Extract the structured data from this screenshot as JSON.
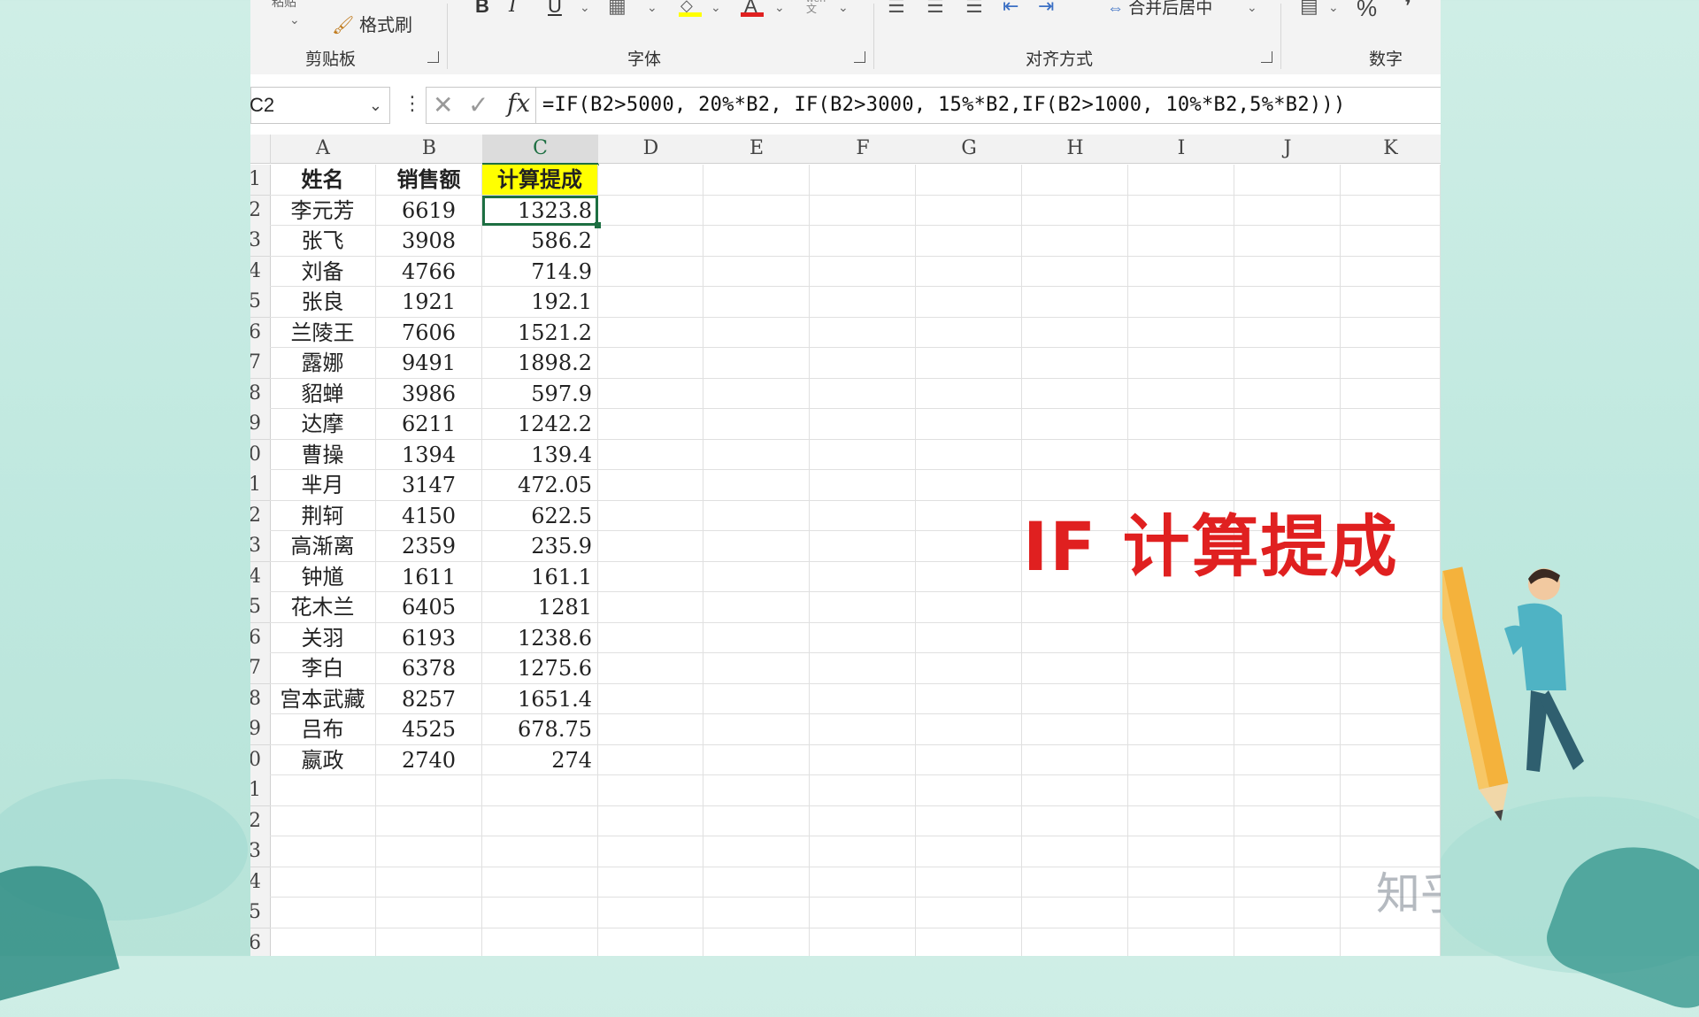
{
  "ribbon": {
    "paste_label": "粘贴",
    "format_painter_label": "格式刷",
    "groups": [
      "剪贴板",
      "字体",
      "对齐方式",
      "数字"
    ],
    "bold": "B",
    "italic": "I",
    "underline": "U",
    "font_color_glyph": "A",
    "merge_center_label": "合并后居中",
    "percent_glyph": "%",
    "wen_glyph": "wen\n文"
  },
  "formula_bar": {
    "name_box": "C2",
    "formula": "=IF(B2>5000, 20%*B2, IF(B2>3000, 15%*B2,IF(B2>1000, 10%*B2,5%*B2)))"
  },
  "columns": [
    "A",
    "B",
    "C",
    "D",
    "E",
    "F",
    "G",
    "H",
    "I",
    "J",
    "K"
  ],
  "row_labels": [
    "1",
    "2",
    "3",
    "4",
    "5",
    "6",
    "7",
    "8",
    "9",
    "0",
    "1",
    "2",
    "3",
    "4",
    "5",
    "6",
    "7",
    "8",
    "9",
    "0",
    "1",
    "2",
    "3",
    "4",
    "5",
    "6"
  ],
  "table": {
    "headers": [
      "姓名",
      "销售额",
      "计算提成"
    ],
    "rows": [
      [
        "李元芳",
        "6619",
        "1323.8"
      ],
      [
        "张飞",
        "3908",
        "586.2"
      ],
      [
        "刘备",
        "4766",
        "714.9"
      ],
      [
        "张良",
        "1921",
        "192.1"
      ],
      [
        "兰陵王",
        "7606",
        "1521.2"
      ],
      [
        "露娜",
        "9491",
        "1898.2"
      ],
      [
        "貂蝉",
        "3986",
        "597.9"
      ],
      [
        "达摩",
        "6211",
        "1242.2"
      ],
      [
        "曹操",
        "1394",
        "139.4"
      ],
      [
        "芈月",
        "3147",
        "472.05"
      ],
      [
        "荆轲",
        "4150",
        "622.5"
      ],
      [
        "高渐离",
        "2359",
        "235.9"
      ],
      [
        "钟馗",
        "1611",
        "161.1"
      ],
      [
        "花木兰",
        "6405",
        "1281"
      ],
      [
        "关羽",
        "6193",
        "1238.6"
      ],
      [
        "李白",
        "6378",
        "1275.6"
      ],
      [
        "宫本武藏",
        "8257",
        "1651.4"
      ],
      [
        "吕布",
        "4525",
        "678.75"
      ],
      [
        "嬴政",
        "2740",
        "274"
      ]
    ]
  },
  "overlay_title": "IF 计算提成",
  "watermark": "知乎 @跟着小兔学Excel",
  "colors": {
    "header_highlight": "#ffff00",
    "selection_green": "#1d6f42",
    "overlay_red": "#e02020",
    "background_teal": "#bfe8df"
  }
}
